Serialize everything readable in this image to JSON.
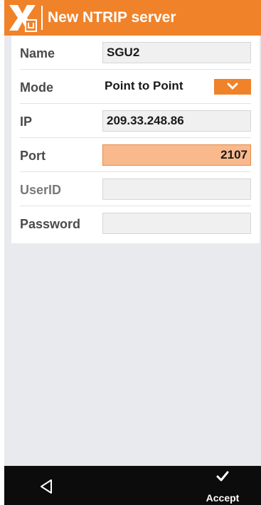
{
  "header": {
    "title": "New NTRIP server",
    "logo_icon": "app-logo-icon"
  },
  "form": {
    "name": {
      "label": "Name",
      "value": "SGU2"
    },
    "mode": {
      "label": "Mode",
      "value": "Point to Point",
      "icon": "chevron-down-icon"
    },
    "ip": {
      "label": "IP",
      "value": "209.33.248.86"
    },
    "port": {
      "label": "Port",
      "value": "2107"
    },
    "userid": {
      "label": "UserID",
      "value": ""
    },
    "password": {
      "label": "Password",
      "value": ""
    }
  },
  "bottom_bar": {
    "back_icon": "back-triangle-icon",
    "accept_icon": "checkmark-icon",
    "accept_label": "Accept"
  },
  "colors": {
    "accent": "#f08229",
    "focused_field": "#f9b98c",
    "background": "#e9eaee",
    "bottom_bar": "#0c0c0c"
  }
}
